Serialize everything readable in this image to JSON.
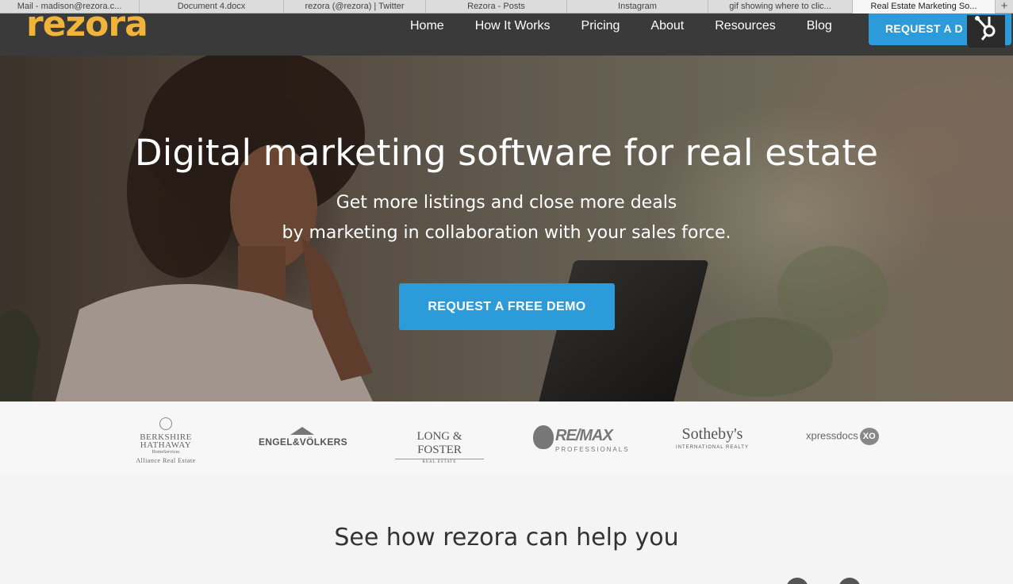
{
  "browser": {
    "tabs": [
      {
        "label": "Mail - madison@rezora.c...",
        "active": false
      },
      {
        "label": "Document 4.docx",
        "active": false
      },
      {
        "label": "rezora (@rezora) | Twitter",
        "active": false
      },
      {
        "label": "Rezora - Posts",
        "active": false
      },
      {
        "label": "Instagram",
        "active": false
      },
      {
        "label": "gif showing where to clic...",
        "active": false
      },
      {
        "label": "Real Estate Marketing So...",
        "active": true
      }
    ],
    "new_tab": "+"
  },
  "header": {
    "logo": "rezora",
    "logo_color": "#f1b43a",
    "nav": [
      "Home",
      "How It Works",
      "Pricing",
      "About",
      "Resources",
      "Blog"
    ],
    "cta": "REQUEST A D",
    "cta_color": "#2c9bd9"
  },
  "hero": {
    "title": "Digital marketing software for real estate",
    "subtitle_line1": "Get more listings and close more deals",
    "subtitle_line2": "by marketing in collaboration with your sales force.",
    "cta": "REQUEST A FREE DEMO"
  },
  "logos": {
    "berkshire": {
      "line1": "BERKSHIRE",
      "line2": "HATHAWAY",
      "line3": "HomeServices",
      "line4": "Alliance Real Estate"
    },
    "engel": "ENGEL&VÖLKERS",
    "longfoster": {
      "name": "LONG & FOSTER",
      "tag": "REAL ESTATE"
    },
    "remax": {
      "name": "RE/MAX",
      "tag": "PROFESSIONALS"
    },
    "sothebys": {
      "name": "Sotheby's",
      "tag": "INTERNATIONAL REALTY"
    },
    "xpressdocs": {
      "name": "xpressdocs",
      "badge": "XO"
    }
  },
  "section": {
    "title": "See how rezora can help you"
  }
}
